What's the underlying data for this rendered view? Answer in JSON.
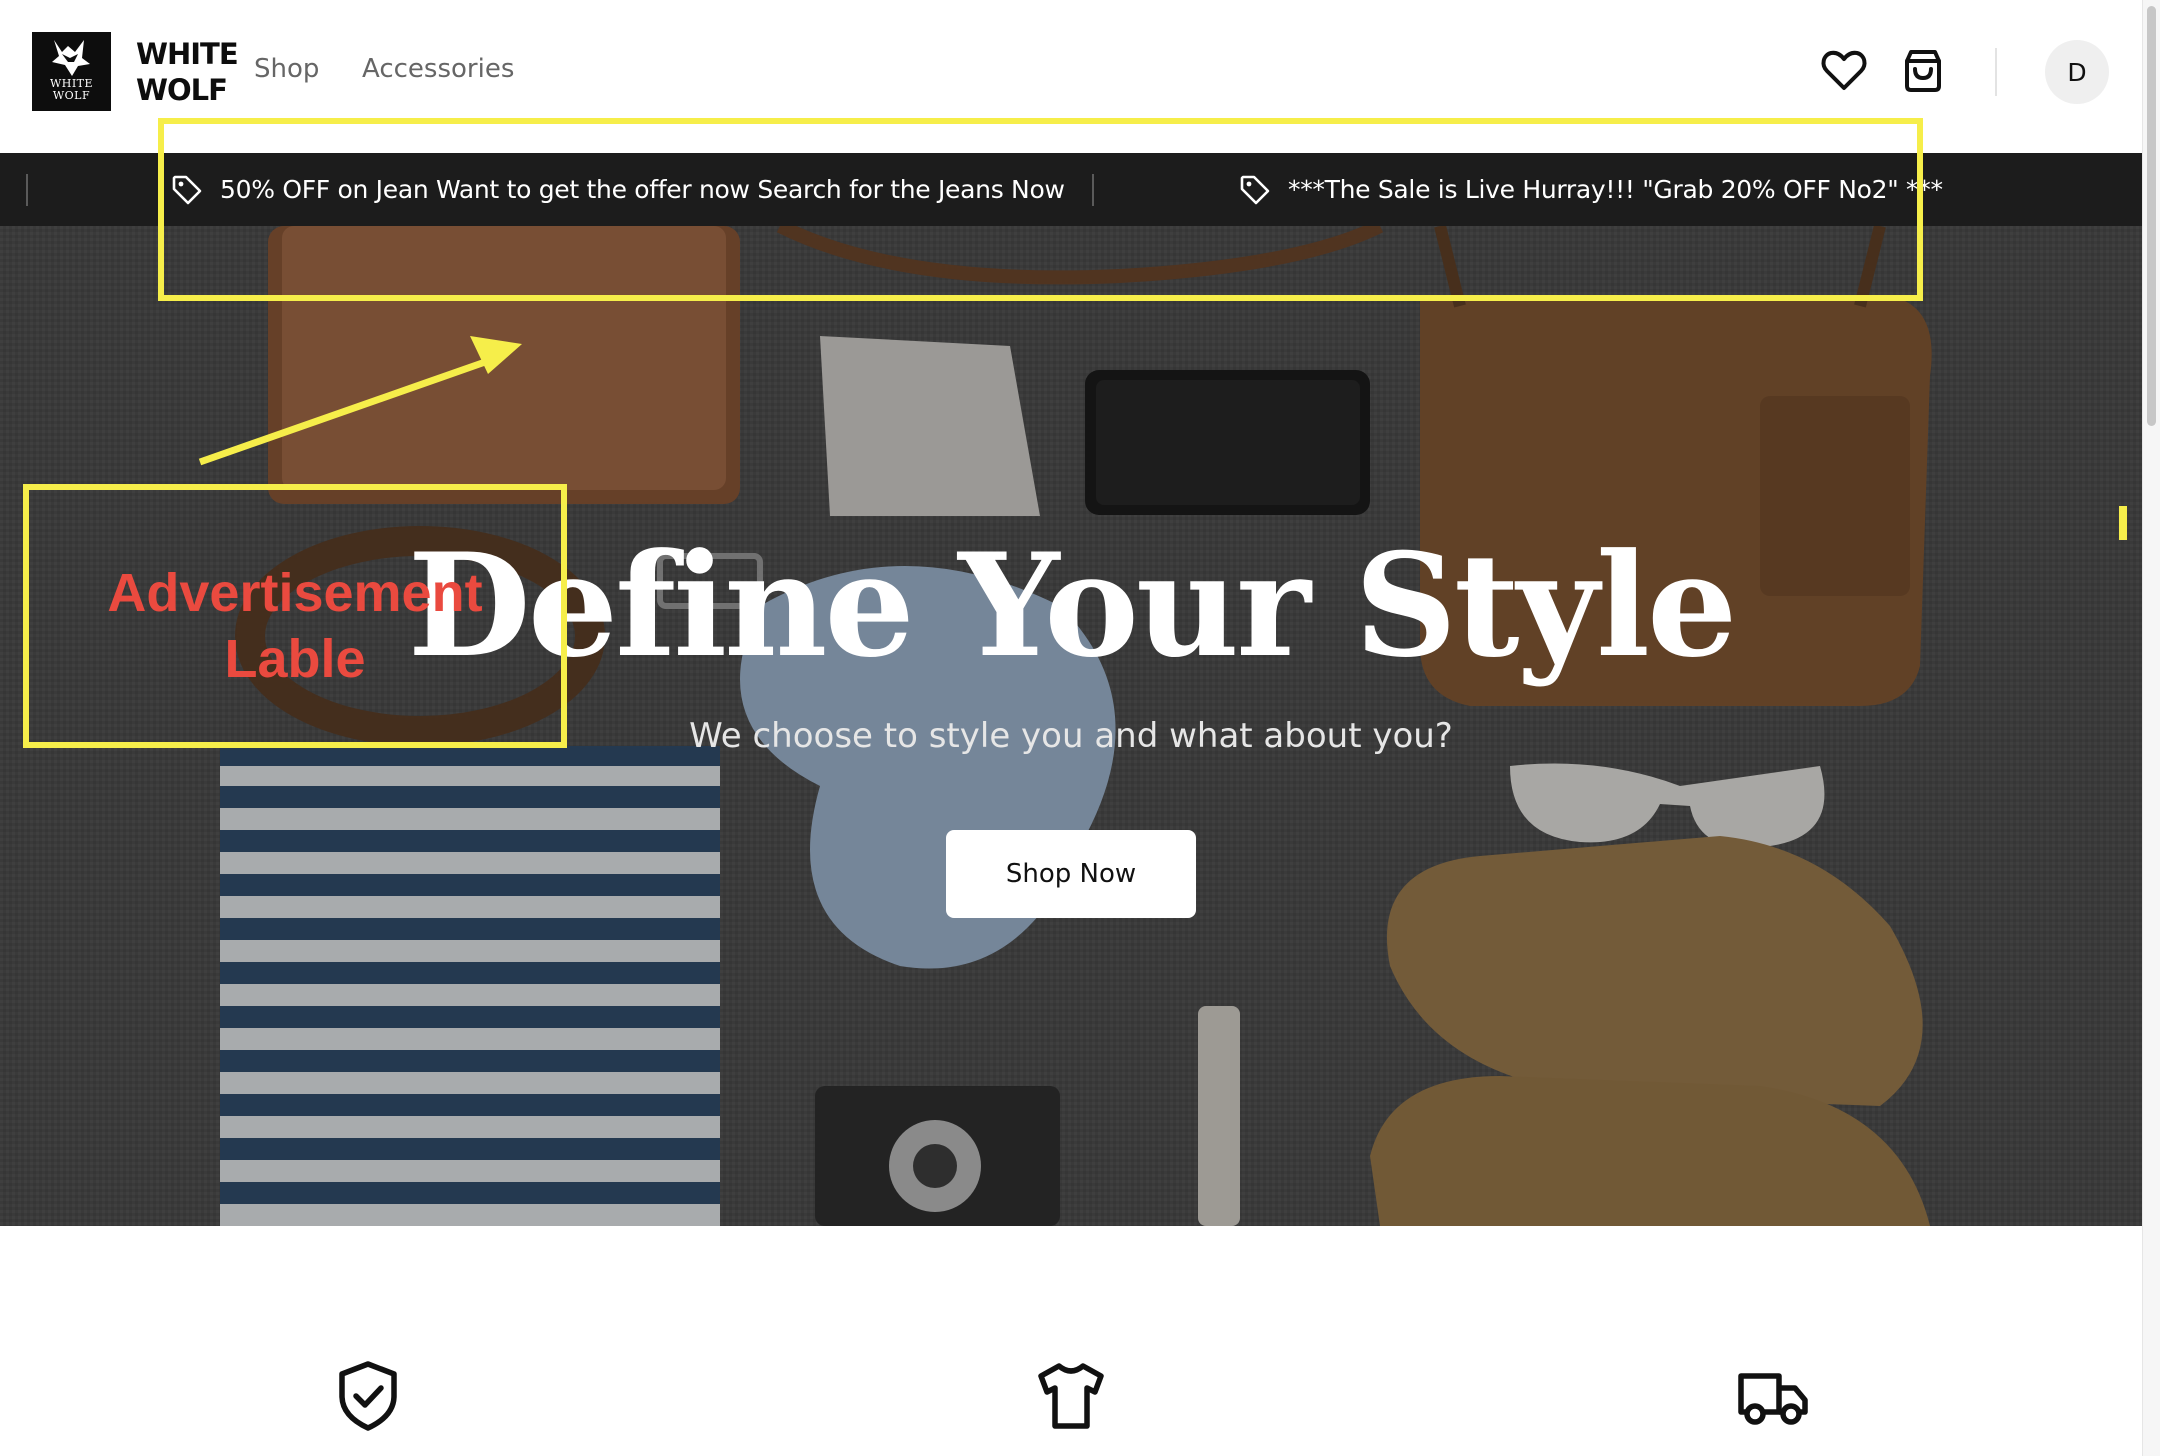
{
  "header": {
    "logo": {
      "line1": "WHITE",
      "line2": "WOLF",
      "icon": "wolf-logo-icon"
    },
    "brand_name": "WHITE WOLF",
    "nav": [
      {
        "label": "Shop"
      },
      {
        "label": "Accessories"
      }
    ],
    "icons": [
      "heart-icon",
      "shopping-bag-icon"
    ],
    "avatar_initial": "D"
  },
  "announcement_bar": {
    "items": [
      {
        "icon": "tag-icon",
        "text": "50% OFF on Jean Want to get the offer now Search for the Jeans Now"
      },
      {
        "icon": "tag-icon",
        "text": "***The Sale is Live Hurray!!! \"Grab 20% OFF No2\" ***"
      }
    ]
  },
  "hero": {
    "title": "Define Your Style",
    "subtitle": "We choose to style you and what about you?",
    "button_label": "Shop Now"
  },
  "features": {
    "icons": [
      "shield-check-icon",
      "tshirt-icon",
      "truck-icon"
    ]
  },
  "annotation": {
    "label_line1": "Advertisement",
    "label_line2": "Lable",
    "color_box": "#f6ee4a",
    "color_text": "#ea4a3f"
  },
  "colors": {
    "header_bg": "#ffffff",
    "bar_bg": "#1c1c1c",
    "logo_bg": "#0d0d0d"
  }
}
